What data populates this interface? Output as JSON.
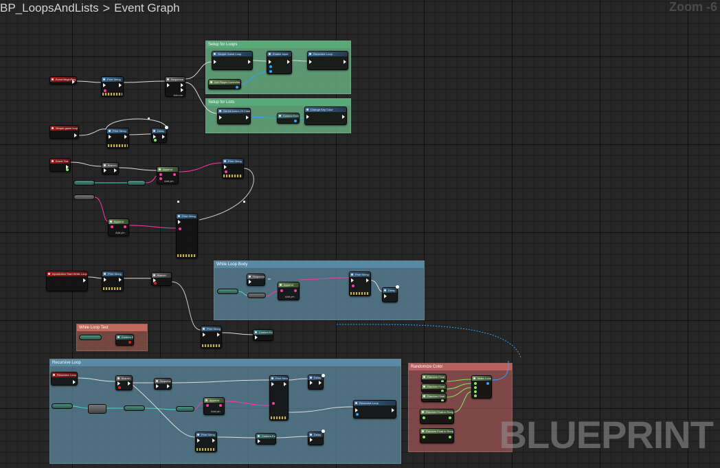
{
  "breadcrumb": {
    "blueprint": "BP_LoopsAndLists",
    "separator": ">",
    "graph": "Event Graph"
  },
  "zoom": "Zoom -6",
  "watermark": "BLUEPRINT",
  "comments": {
    "setup_loops": "Setup for Loops",
    "setup_lists": "Setup for Lists",
    "while_loop_body": "While Loop Body",
    "while_loop_test": "While Loop Test",
    "recursive_loop": "Recursive Loop",
    "randomize_color": "Randomize Color"
  },
  "nodes": {
    "event_begin_play": "Event BeginPlay",
    "print_string": "Print String",
    "sequence": "Sequence",
    "add_pin": "Add pin",
    "simple_game_loop": "Simple Game Loop",
    "enable_input": "Enable Input",
    "recursive_loop": "Recursive Loop",
    "get_player_controller": "Get Player Controller",
    "set_list": "Set All Actors Of Class",
    "change_key": "Change Key Color",
    "simple_game_loop_event": "Simple game loop",
    "delay": "Delay",
    "event_tick": "Event Tick",
    "append": "Append",
    "input_while": "InputAction Start While Loop",
    "branch": "Branch",
    "random_float": "Random Float",
    "random_float_range": "Random Float in Range",
    "make_color": "Make Color",
    "recursive_loop_event": "Recursive Loop",
    "custom_event": "Custom Event"
  },
  "colors": {
    "exec": "#f0f0f0",
    "string": "#ff39a8",
    "object": "#2aa6ff",
    "float": "#7cf05a",
    "bool": "#dd2222"
  }
}
